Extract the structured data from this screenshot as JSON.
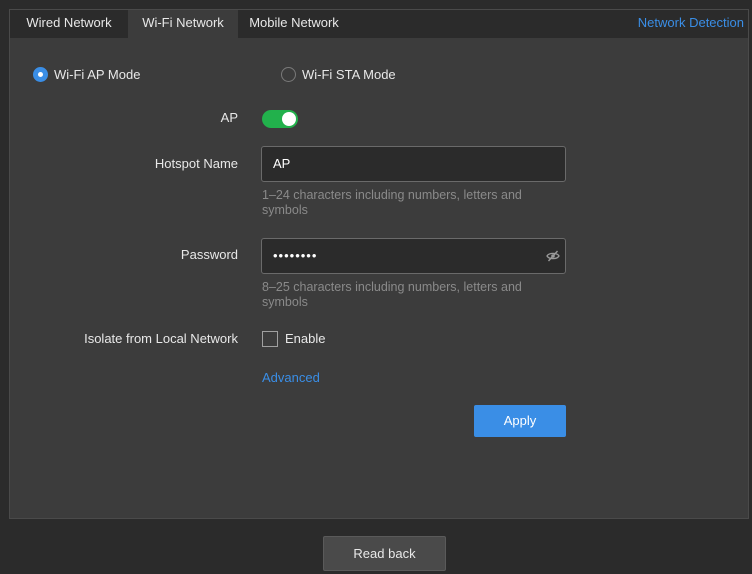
{
  "tabs": [
    {
      "label": "Wired Network",
      "active": false
    },
    {
      "label": "Wi-Fi Network",
      "active": true
    },
    {
      "label": "Mobile Network",
      "active": false
    }
  ],
  "header": {
    "network_detection": "Network Detection"
  },
  "mode": {
    "ap_label": "Wi-Fi AP Mode",
    "sta_label": "Wi-Fi STA Mode",
    "selected": "ap"
  },
  "form": {
    "ap_label": "AP",
    "ap_enabled": true,
    "hotspot_label": "Hotspot Name",
    "hotspot_value": "AP",
    "hotspot_hint": "1–24 characters including numbers, letters and symbols",
    "password_label": "Password",
    "password_value": "••••••••",
    "password_hint": "8–25 characters including numbers, letters and symbols",
    "isolate_label": "Isolate from Local Network",
    "isolate_checkbox_label": "Enable",
    "isolate_checked": false,
    "advanced_link": "Advanced"
  },
  "buttons": {
    "apply": "Apply",
    "read_back": "Read back"
  },
  "colors": {
    "accent": "#3a8ee6",
    "toggle_on": "#22b14c",
    "panel_bg": "#3c3c3c",
    "page_bg": "#2b2b2b"
  },
  "icons": {
    "password_visibility": "eye-slash-icon"
  }
}
